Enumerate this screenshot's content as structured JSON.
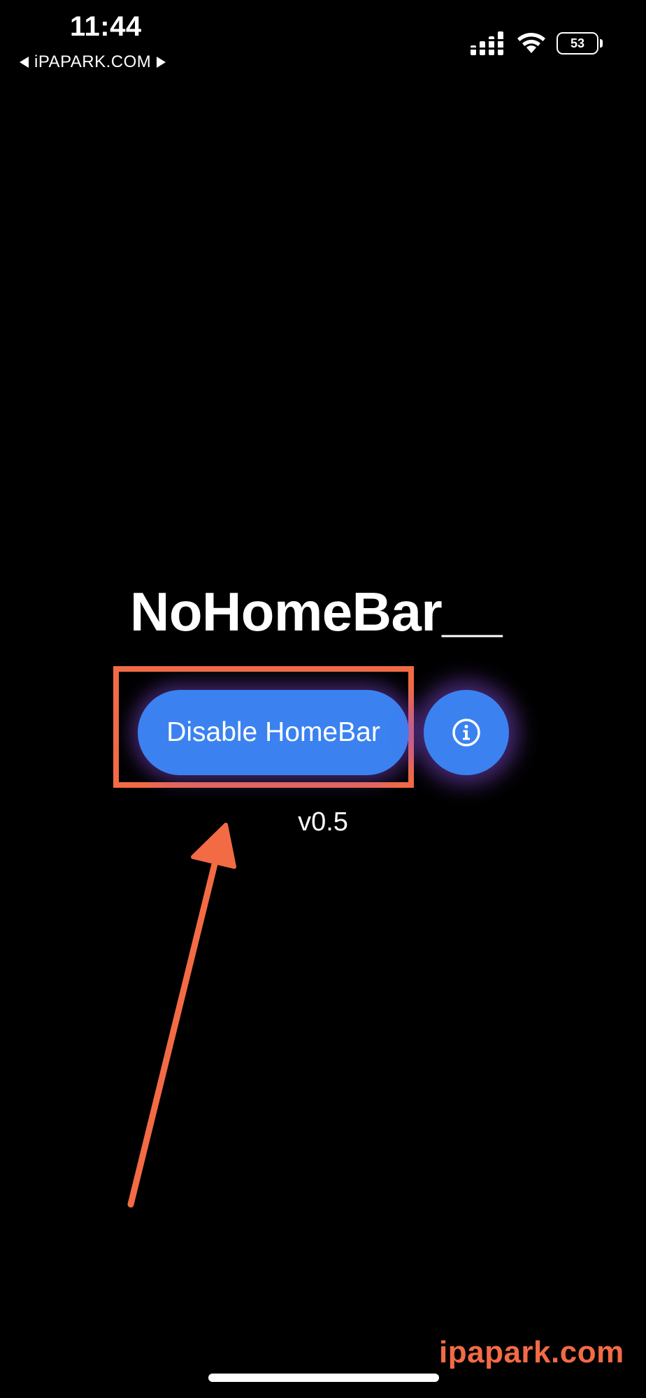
{
  "status_bar": {
    "time": "11:44",
    "back_label": "iPAPARK.COM",
    "battery_level": "53",
    "icons": [
      "signal-icon",
      "wifi-icon",
      "battery-icon"
    ]
  },
  "main": {
    "title": "NoHomeBar__",
    "primary_button_label": "Disable HomeBar",
    "info_button_icon": "info-icon",
    "version": "v0.5"
  },
  "annotation": {
    "highlight": "orange-rectangle",
    "pointer": "orange-arrow"
  },
  "watermark": "ipapark.com",
  "colors": {
    "background": "#000000",
    "button": "#3b82f0",
    "glow": "#8c50e6",
    "annotation": "#f26b45"
  }
}
